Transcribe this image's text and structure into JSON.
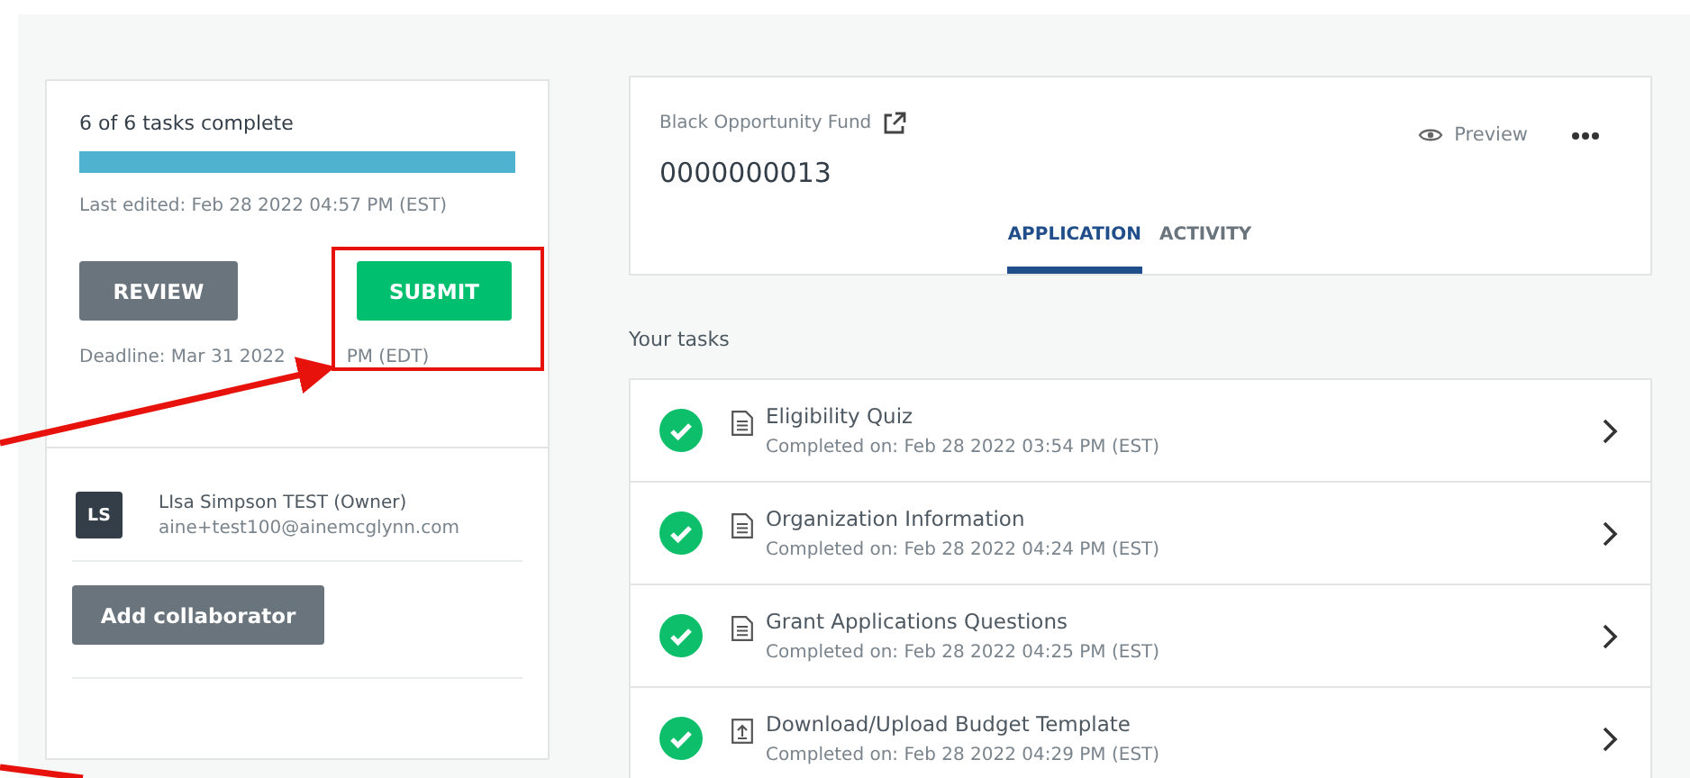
{
  "progress": {
    "label": "6 of 6 tasks complete",
    "level": 1
  },
  "last_edited": "Last edited: Feb 28 2022 04:57 PM (EST)",
  "buttons": [
    {
      "label": "REVIEW",
      "kind": "secondary"
    },
    {
      "label": "SUBMIT",
      "kind": "primary"
    }
  ],
  "deadline": [
    "Deadline: Mar 31 2022",
    "PM (EDT)"
  ],
  "collaborator": {
    "initials": "LS",
    "name": "LIsa Simpson TEST (Owner)",
    "email": "aine+test100@ainemcglynn.com"
  },
  "add_collaborator": "Add collaborator",
  "header": {
    "fund": "Black Opportunity Fund",
    "number": "0000000013",
    "preview": "Preview"
  },
  "tabs": [
    {
      "label": "APPLICATION",
      "selected": true
    },
    {
      "label": "ACTIVITY",
      "selected": false
    }
  ],
  "tasks_heading": "Your tasks",
  "tasks": [
    {
      "title": "Eligibility Quiz",
      "completed": "Completed on: Feb 28 2022 03:54 PM (EST)",
      "kind": "form",
      "done": true
    },
    {
      "title": "Organization Information",
      "completed": "Completed on: Feb 28 2022 04:24 PM (EST)",
      "kind": "form",
      "done": true
    },
    {
      "title": "Grant Applications Questions",
      "completed": "Completed on: Feb 28 2022 04:25 PM (EST)",
      "kind": "form",
      "done": true
    },
    {
      "title": "Download/Upload Budget Template",
      "completed": "Completed on: Feb 28 2022 04:29 PM (EST)",
      "kind": "upload",
      "done": true
    }
  ]
}
